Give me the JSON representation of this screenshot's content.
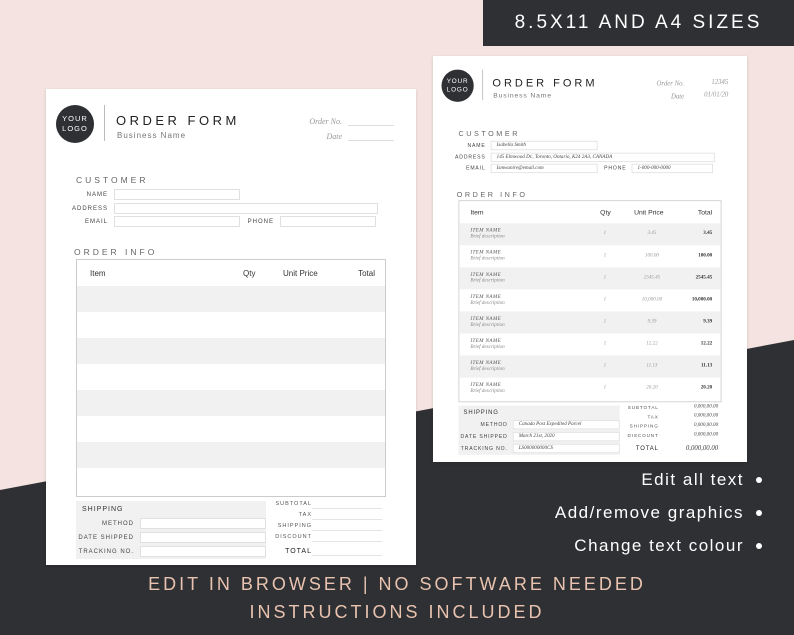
{
  "banner": "8.5X11 AND A4 SIZES",
  "logo": {
    "line1": "YOUR",
    "line2": "LOGO"
  },
  "form": {
    "title": "ORDER FORM",
    "business_name": "Business Name",
    "order_no_label": "Order No.",
    "date_label": "Date",
    "customer_heading": "CUSTOMER",
    "labels": {
      "name": "NAME",
      "address": "ADDRESS",
      "email": "EMAIL",
      "phone": "PHONE"
    },
    "order_info_heading": "ORDER INFO",
    "columns": {
      "item": "Item",
      "qty": "Qty",
      "price": "Unit Price",
      "total": "Total"
    },
    "shipping_heading": "SHIPPING",
    "ship_labels": {
      "method": "METHOD",
      "date": "DATE SHIPPED",
      "tracking": "TRACKING NO."
    },
    "total_labels": {
      "subtotal": "SUBTOTAL",
      "tax": "TAX",
      "shipping": "SHIPPING",
      "discount": "DISCOUNT",
      "total": "TOTAL"
    }
  },
  "filled": {
    "order_no": "12345",
    "date": "01/01/20",
    "name": "Isabella Smith",
    "address": "145 Elmwood Dr., Toronto, Ontario, K24 2A3, CANADA",
    "email": "Ismwanire@email.com",
    "phone": "1-000-000-0000",
    "items": [
      {
        "name": "ITEM NAME",
        "desc": "Brief description",
        "qty": "1",
        "price": "3.45",
        "total": "3.45"
      },
      {
        "name": "ITEM NAME",
        "desc": "Brief description",
        "qty": "1",
        "price": "100.00",
        "total": "100.00"
      },
      {
        "name": "ITEM NAME",
        "desc": "Brief description",
        "qty": "1",
        "price": "2545.45",
        "total": "2545.45"
      },
      {
        "name": "ITEM NAME",
        "desc": "Brief description",
        "qty": "1",
        "price": "10,000.00",
        "total": "10,000.00"
      },
      {
        "name": "ITEM NAME",
        "desc": "Brief description",
        "qty": "1",
        "price": "9.39",
        "total": "9.39"
      },
      {
        "name": "ITEM NAME",
        "desc": "Brief description",
        "qty": "1",
        "price": "12.22",
        "total": "12.22"
      },
      {
        "name": "ITEM NAME",
        "desc": "Brief description",
        "qty": "1",
        "price": "11.13",
        "total": "11.13"
      },
      {
        "name": "ITEM NAME",
        "desc": "Brief description",
        "qty": "1",
        "price": "20.20",
        "total": "20.20"
      }
    ],
    "ship_method": "Canada Post Expedited Parcel",
    "ship_date": "March 21st, 2020",
    "tracking": "LS000000000CS",
    "subtotal": "0,000,00.00",
    "tax": "0,000,00.00",
    "shipping": "0,000,00.00",
    "discount": "0,000,00.00",
    "total": "0,000,00.00"
  },
  "features": [
    "Edit all text",
    "Add/remove graphics",
    "Change text colour"
  ],
  "footer": {
    "line1": "EDIT IN BROWSER | NO SOFTWARE NEEDED",
    "line2": "INSTRUCTIONS INCLUDED"
  }
}
